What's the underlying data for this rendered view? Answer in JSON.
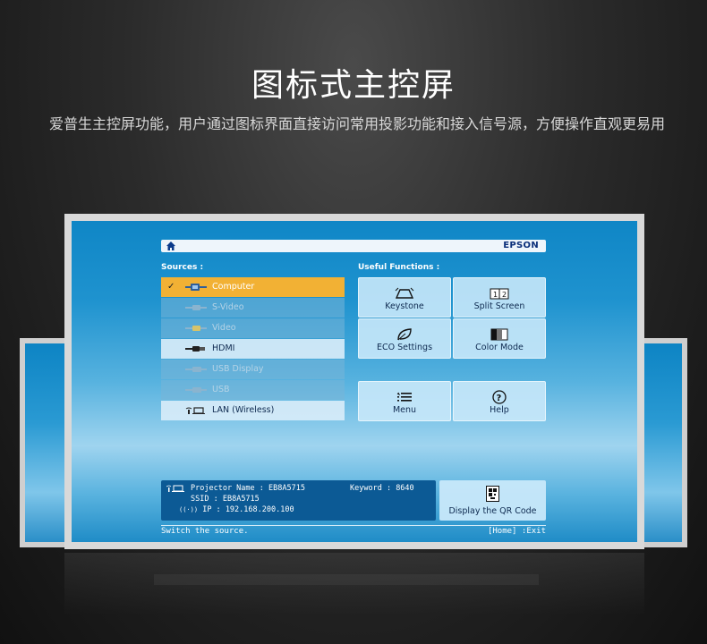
{
  "page": {
    "title": "图标式主控屏",
    "description": "爱普生主控屏功能，用户通过图标界面直接访问常用投影功能和接入信号源，方便操作直观更易用"
  },
  "projector_ui": {
    "brand": "EPSON",
    "home_icon": "home-icon",
    "sources_label": "Sources :",
    "functions_label": "Useful Functions :",
    "sources": [
      {
        "label": "Computer",
        "icon": "computer-input-icon",
        "state": "selected",
        "checked": true
      },
      {
        "label": "S-Video",
        "icon": "svideo-input-icon",
        "state": "disabled",
        "checked": false
      },
      {
        "label": "Video",
        "icon": "video-input-icon",
        "state": "disabled",
        "checked": false
      },
      {
        "label": "HDMI",
        "icon": "hdmi-input-icon",
        "state": "enabled",
        "checked": false
      },
      {
        "label": "USB Display",
        "icon": "usb-display-icon",
        "state": "disabled",
        "checked": false
      },
      {
        "label": "USB",
        "icon": "usb-icon",
        "state": "disabled",
        "checked": false
      },
      {
        "label": "LAN (Wireless)",
        "icon": "lan-wireless-icon",
        "state": "enabled",
        "checked": false
      }
    ],
    "functions": [
      {
        "label": "Keystone",
        "icon": "keystone-icon"
      },
      {
        "label": "Split Screen",
        "icon": "split-screen-icon"
      },
      {
        "label": "ECO Settings",
        "icon": "eco-leaf-icon"
      },
      {
        "label": "Color Mode",
        "icon": "color-mode-icon"
      },
      {
        "label": "Menu",
        "icon": "menu-list-icon"
      },
      {
        "label": "Help",
        "icon": "help-icon"
      }
    ],
    "network": {
      "projector_name_label": "Projector Name :",
      "projector_name": "EB8A5715",
      "ssid_label": "SSID :",
      "ssid": "EB8A5715",
      "ip_label": "IP :",
      "ip": "192.168.200.100",
      "keyword_label": "Keyword :",
      "keyword": "8640"
    },
    "qr_button": "Display the QR Code",
    "status_left": "Switch the source.",
    "status_right": "[Home] :Exit"
  },
  "colors": {
    "screen_blue": "#1f93cf",
    "selected_orange": "#f2b134",
    "info_panel": "#0c5a95",
    "brand_text": "#0b2f7a"
  }
}
